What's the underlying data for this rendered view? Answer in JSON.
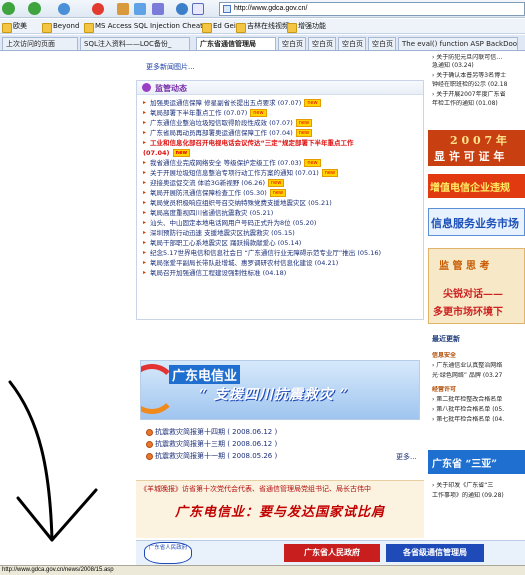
{
  "browser": {
    "address": "http://www.gdca.gov.cn/",
    "status_url": "http://www.gdca.gov.cn/news/2008/15.asp"
  },
  "favorites": [
    "Beyond",
    "MS Access SQL Injection Cheat ...",
    "Ed Gein",
    "吉林在线视频",
    "增强功能"
  ],
  "favorites_lead": "欧美",
  "tabs": [
    "上次访问的页面",
    "SQL注入资料——LOC备份_",
    "广东省通信管理局",
    "空白页",
    "空白页",
    "空白页",
    "空白页",
    "The eval() function ASP BackDoor Cl..."
  ],
  "main": {
    "more_images": "更多新闻图片...",
    "supervision": {
      "title": "监管动态",
      "items": [
        {
          "text": "加强奥运通信保障 修星副省长提出五点要求 (07.07)",
          "new": true
        },
        {
          "text": "氧局部署下半年重点工作 (07.07)",
          "new": true
        },
        {
          "text": "广东通信业整治垃圾短信取得阶段性成效 (07.07)",
          "new": true
        },
        {
          "text": "广东省局再动员再部署奥运通信保障工作 (07.04)",
          "new": true
        },
        {
          "text": "工业和信息化部召开电视电话会议传达“三定”规定部署下半年重点工作",
          "new": false,
          "red": true
        },
        {
          "text": "(07.04)",
          "new": true,
          "red_cont": true
        },
        {
          "text": "我省通信业完成网络安全 等级保护定级工作 (07.03)",
          "new": true
        },
        {
          "text": "关于开展垃圾短信息整治专项行动工作方案的通知 (07.01)",
          "new": true
        },
        {
          "text": "迎接奥运促交流 体验3G新视野 (06.26)",
          "new": true
        },
        {
          "text": "氧局开展防汛通信保障检查工作 (05.30)",
          "new": true
        },
        {
          "text": "氧局党员积极响应组织号召交纳特殊党费支援地震灾区 (05.21)",
          "new": false
        },
        {
          "text": "氧局高度重视四川省通信抗震救灾 (05.21)",
          "new": false
        },
        {
          "text": "汕头、中山固定本地电话网用户号码正式升为8位 (05.20)",
          "new": false
        },
        {
          "text": "深圳预防行动迅速 支援地震灾区抗震救灾 (05.15)",
          "new": false
        },
        {
          "text": "氧局干部职工心系地震灾区 踊跃捐款献爱心 (05.14)",
          "new": false
        },
        {
          "text": "纪念5.17世界电信和信息社会日 “广东通信行业无障碍示范专业厅”推出 (05.16)",
          "new": false
        },
        {
          "text": "氧局张爱平副局长带队赴增城、惠罗调研农村信息化建设 (04.21)",
          "new": false
        },
        {
          "text": "氧局召开加强通信工程建设强制性标准 (04.18)",
          "new": false
        }
      ]
    },
    "banner": {
      "line1": "广东电信业",
      "line2": "“ 支援四川抗震救灾 ”"
    },
    "relief": [
      "抗震救灾简报第十四期 ( 2008.06.12 )",
      "抗震救灾简报第十三期 ( 2008.06.12 )",
      "抗震救灾简报第十一期 ( 2008.05.26 )"
    ],
    "more_label": "更多...",
    "quote": {
      "text": "《羊城晚报》访省第十次党代会代表、省通信管理局党组书记、局长古伟中",
      "slogan": "广东电信业：要与发达国家试比肩"
    },
    "bottom": {
      "logo_text": "广东省人民政府",
      "item1": "广东省人民政府",
      "item2": "各省级通信管理局"
    }
  },
  "right": {
    "top_lines": [
      "› 关于防犯元旦闪联可信…",
      "急通知 (03.24)",
      "› 关于确认本普另等3名博士",
      "钟经在职班检的公示 (02.18",
      "› 关于开展2007年度广东省",
      "年检工作的通知 (01.08)"
    ],
    "b1": "2 0 0 7 年",
    "b1b": "显 许 可 证 年",
    "b2": "增值电信企业违规",
    "b3": "信息服务业务市场",
    "b4a": "监  管  思  考",
    "b4b": "尖锐对话——",
    "b4c": "多更市场环境下",
    "recent_title": "最近更新",
    "recent": [
      "信息安全",
      "› 广东通信业认真整治网络",
      "光·绿色网络” 品牌 (03.27",
      "经营许可",
      "› 第二批年检整改合格名单",
      "› 第八批年检合格名单 (05.",
      "› 第七批年检合格名单 (04."
    ],
    "b5": "广东省 “三亚”",
    "tail": [
      "› 关于印发《广东省“三",
      "工作事项》的通知 (09.28)"
    ]
  },
  "colors": {
    "link": "#1b2f7a",
    "accent_red": "#d11111",
    "heading_purple": "#7a2ea8"
  }
}
